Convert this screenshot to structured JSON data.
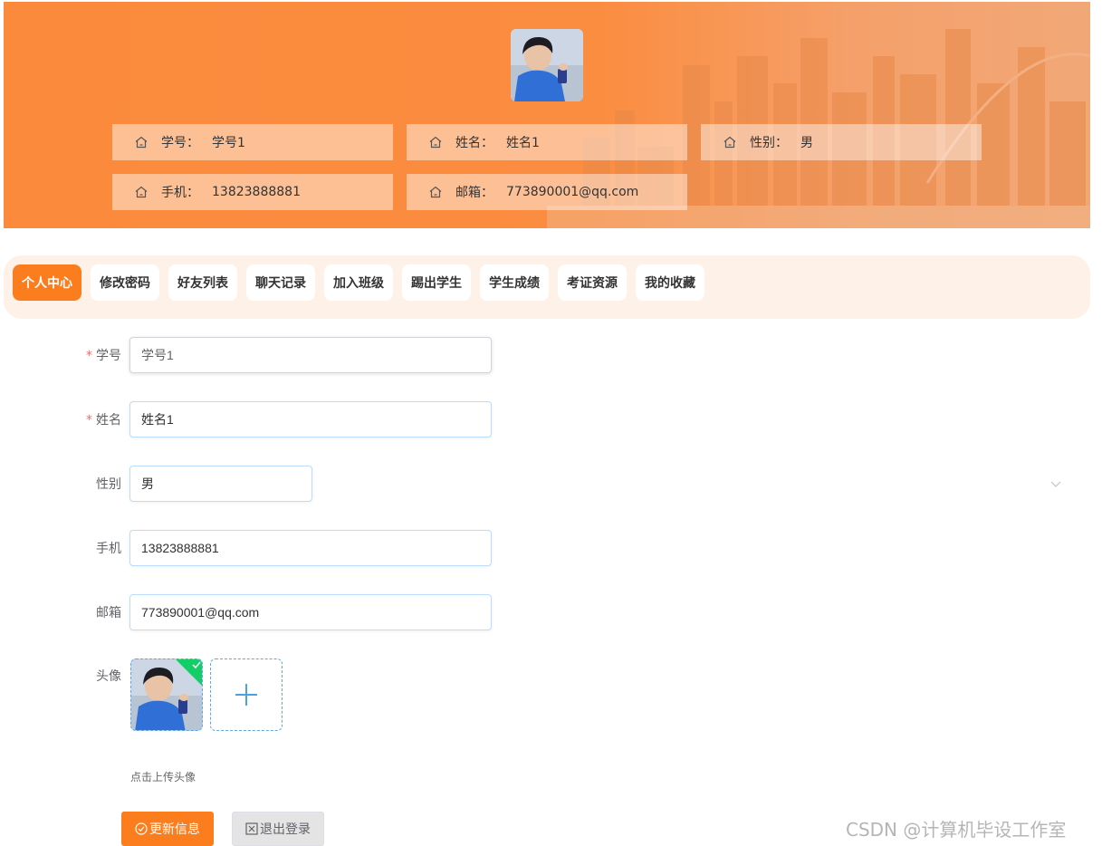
{
  "header": {
    "cards": [
      {
        "label": "学号：",
        "value": "学号1"
      },
      {
        "label": "姓名：",
        "value": "姓名1"
      },
      {
        "label": "性别：",
        "value": "男"
      },
      {
        "label": "手机：",
        "value": "13823888881"
      },
      {
        "label": "邮箱：",
        "value": "773890001@qq.com"
      }
    ]
  },
  "tabs": [
    {
      "label": "个人中心",
      "active": true
    },
    {
      "label": "修改密码"
    },
    {
      "label": "好友列表"
    },
    {
      "label": "聊天记录"
    },
    {
      "label": "加入班级"
    },
    {
      "label": "踢出学生"
    },
    {
      "label": "学生成绩"
    },
    {
      "label": "考证资源"
    },
    {
      "label": "我的收藏"
    }
  ],
  "form": {
    "required_mark": "*",
    "student_id": {
      "label": "学号",
      "value": "学号1"
    },
    "name": {
      "label": "姓名",
      "value": "姓名1"
    },
    "gender": {
      "label": "性别",
      "value": "男"
    },
    "phone": {
      "label": "手机",
      "value": "13823888881"
    },
    "email": {
      "label": "邮箱",
      "value": "773890001@qq.com"
    },
    "avatar": {
      "label": "头像",
      "hint": "点击上传头像"
    }
  },
  "buttons": {
    "update": "更新信息",
    "logout": "退出登录"
  },
  "watermark": "CSDN @计算机毕设工作室",
  "colors": {
    "accent": "#fb7d1e",
    "banner": "#fb8a3c",
    "tabbar_bg": "#fef1e7",
    "input_border": "#b9dcff",
    "success": "#13ce66",
    "required": "#f56c6c"
  },
  "icons": {
    "card": "home-outline-icon",
    "select": "chevron-down-icon",
    "upload": "plus-icon",
    "uploaded": "check-icon",
    "update_button": "circle-check-icon",
    "logout_button": "square-close-icon"
  }
}
